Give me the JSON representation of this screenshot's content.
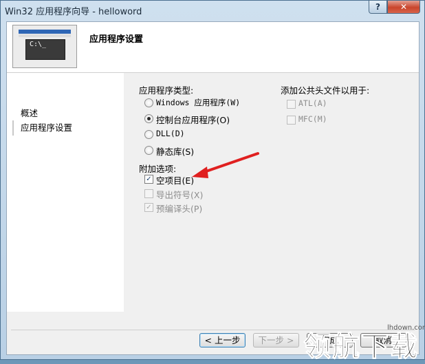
{
  "window": {
    "title": "Win32 应用程序向导 - helloword",
    "help_glyph": "?",
    "close_glyph": "✕"
  },
  "header": {
    "title": "应用程序设置",
    "console_text": "C:\\_"
  },
  "nav": {
    "items": [
      "概述",
      "应用程序设置"
    ]
  },
  "app_type": {
    "label": "应用程序类型:",
    "options": [
      {
        "label": "Windows 应用程序(W)",
        "selected": false
      },
      {
        "label": "控制台应用程序(O)",
        "selected": true
      },
      {
        "label": "DLL(D)",
        "selected": false
      },
      {
        "label": "静态库(S)",
        "selected": false
      }
    ]
  },
  "additional": {
    "label": "附加选项:",
    "options": [
      {
        "label": "空项目(E)",
        "checked": true,
        "enabled": true
      },
      {
        "label": "导出符号(X)",
        "checked": false,
        "enabled": false
      },
      {
        "label": "预编译头(P)",
        "checked": true,
        "enabled": false
      }
    ]
  },
  "common_headers": {
    "label": "添加公共头文件以用于:",
    "options": [
      {
        "label": "ATL(A)",
        "checked": false,
        "enabled": false
      },
      {
        "label": "MFC(M)",
        "checked": false,
        "enabled": false
      }
    ]
  },
  "buttons": {
    "prev": "< 上一步",
    "next": "下一步 >",
    "finish": "完成",
    "cancel": "取消"
  },
  "watermark": {
    "small": "lhdown.com",
    "big": "领航下载"
  },
  "colors": {
    "arrow": "#e02020",
    "title_bar": "#b9d0e5"
  },
  "check_glyph": "✓"
}
